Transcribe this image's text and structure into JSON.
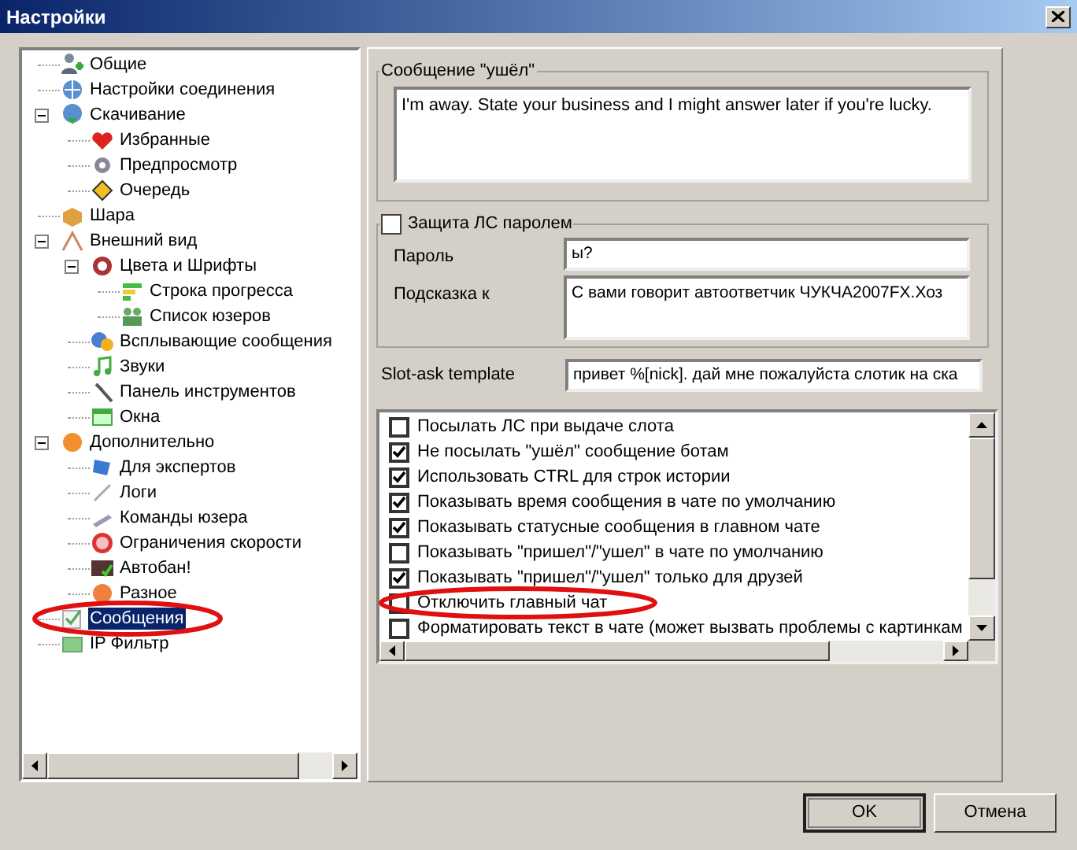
{
  "window": {
    "title": "Настройки"
  },
  "tree": [
    {
      "label": "Общие",
      "selected": false,
      "circled": false
    },
    {
      "label": "Настройки соединения",
      "selected": false,
      "circled": false
    },
    {
      "label": "Скачивание",
      "selected": false,
      "circled": false,
      "expanded": true,
      "children": [
        {
          "label": "Избранные",
          "selected": false,
          "circled": false
        },
        {
          "label": "Предпросмотр",
          "selected": false,
          "circled": false
        },
        {
          "label": "Очередь",
          "selected": false,
          "circled": false
        }
      ]
    },
    {
      "label": "Шара",
      "selected": false,
      "circled": false
    },
    {
      "label": "Внешний вид",
      "selected": false,
      "circled": false,
      "expanded": true,
      "children": [
        {
          "label": "Цвета и Шрифты",
          "selected": false,
          "circled": false,
          "expanded": true,
          "children": [
            {
              "label": "Строка прогресса",
              "selected": false,
              "circled": false
            },
            {
              "label": "Список юзеров",
              "selected": false,
              "circled": false
            }
          ]
        },
        {
          "label": "Всплывающие сообщения",
          "selected": false,
          "circled": false
        },
        {
          "label": "Звуки",
          "selected": false,
          "circled": false
        },
        {
          "label": "Панель инструментов",
          "selected": false,
          "circled": false
        },
        {
          "label": "Окна",
          "selected": false,
          "circled": false
        }
      ]
    },
    {
      "label": "Дополнительно",
      "selected": false,
      "circled": false,
      "expanded": true,
      "children": [
        {
          "label": "Для экспертов",
          "selected": false,
          "circled": false
        },
        {
          "label": "Логи",
          "selected": false,
          "circled": false
        },
        {
          "label": "Команды юзера",
          "selected": false,
          "circled": false
        },
        {
          "label": "Ограничения скорости",
          "selected": false,
          "circled": false
        },
        {
          "label": "Автобан!",
          "selected": false,
          "circled": false
        },
        {
          "label": "Разное",
          "selected": false,
          "circled": false
        }
      ]
    },
    {
      "label": "Сообщения",
      "selected": true,
      "circled": true
    },
    {
      "label": "IP Фильтр",
      "selected": false,
      "circled": false
    }
  ],
  "away_message": {
    "legend": "Сообщение \"ушёл\"",
    "value": "I'm away. State your business and I might answer later if you're lucky."
  },
  "pm_protection": {
    "label": "Защита ЛС паролем",
    "checked": false,
    "fields": [
      {
        "label": "Пароль",
        "value": "ы?",
        "multiline": false
      },
      {
        "label": "Подсказка к",
        "value": "С вами говорит автоответчик ЧУКЧА2007FX.Хоз",
        "multiline": true
      }
    ]
  },
  "slot_ask": {
    "label": "Slot-ask template",
    "value": "привет %[nick]. дай мне пожалуйста слотик на ска"
  },
  "options": [
    {
      "label": "Посылать ЛС при выдаче слота",
      "checked": false,
      "circled": false
    },
    {
      "label": "Не посылать \"ушёл\" сообщение ботам",
      "checked": true,
      "circled": false
    },
    {
      "label": "Использовать CTRL для строк истории",
      "checked": true,
      "circled": false
    },
    {
      "label": "Показывать время сообщения в чате по умолчанию",
      "checked": true,
      "circled": false
    },
    {
      "label": "Показывать статусные сообщения в главном чате",
      "checked": true,
      "circled": false
    },
    {
      "label": "Показывать \"пришел\"/\"ушел\" в чате по умолчанию",
      "checked": false,
      "circled": false
    },
    {
      "label": "Показывать \"пришел\"/\"ушел\" только для друзей",
      "checked": true,
      "circled": false
    },
    {
      "label": "Отключить главный чат",
      "checked": false,
      "circled": true
    },
    {
      "label": "Форматировать текст в чате (может вызвать проблемы с картинкам",
      "checked": false,
      "circled": false
    }
  ],
  "buttons": [
    {
      "label": "OK",
      "default": true
    },
    {
      "label": "Отмена",
      "default": false
    }
  ]
}
